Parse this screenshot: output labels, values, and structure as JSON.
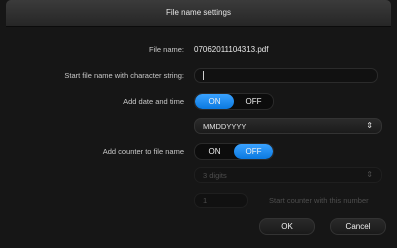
{
  "dialog": {
    "title": "File name settings"
  },
  "file_name": {
    "label": "File name:",
    "value": "07062011104313.pdf"
  },
  "start_string": {
    "label": "Start file name with character string:",
    "value": ""
  },
  "date_time": {
    "label": "Add date and time",
    "on_label": "ON",
    "off_label": "OFF",
    "selected": "ON",
    "format": "MMDDYYYY"
  },
  "counter": {
    "label": "Add counter to file name",
    "on_label": "ON",
    "off_label": "OFF",
    "selected": "OFF",
    "digits": "3 digits",
    "start_value": "1",
    "start_label": "Start counter with this number"
  },
  "buttons": {
    "ok": "OK",
    "cancel": "Cancel"
  },
  "colors": {
    "accent": "#1e8cf0",
    "background": "#161616"
  },
  "icons": {
    "select_arrow": "up-down-arrows-icon"
  }
}
